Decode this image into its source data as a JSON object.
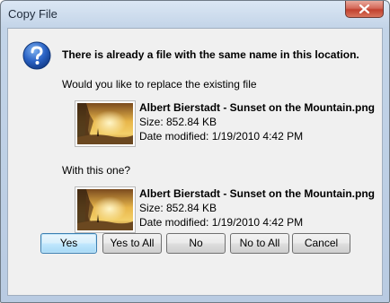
{
  "window": {
    "title": "Copy File"
  },
  "dialog": {
    "heading": "There is already a file with the same name in this location.",
    "replace_prompt": "Would you like to replace the existing file",
    "existing_file": {
      "name": "Albert Bierstadt - Sunset on the Mountain.png",
      "size": "Size: 852.84 KB",
      "modified": "Date modified: 1/19/2010 4:42 PM"
    },
    "with_prompt": "With this one?",
    "new_file": {
      "name": "Albert Bierstadt - Sunset on the Mountain.png",
      "size": "Size: 852.84 KB",
      "modified": "Date modified: 1/19/2010 4:42 PM"
    }
  },
  "buttons": {
    "yes": "Yes",
    "yes_to_all": "Yes to All",
    "no": "No",
    "no_to_all": "No to All",
    "cancel": "Cancel"
  },
  "icons": {
    "question": "question-icon",
    "close": "close-icon",
    "thumbnail": "image-thumbnail"
  },
  "colors": {
    "default_button_border": "#3c7fb1",
    "close_button": "#c1412e",
    "question_icon": "#1e4fa8"
  }
}
